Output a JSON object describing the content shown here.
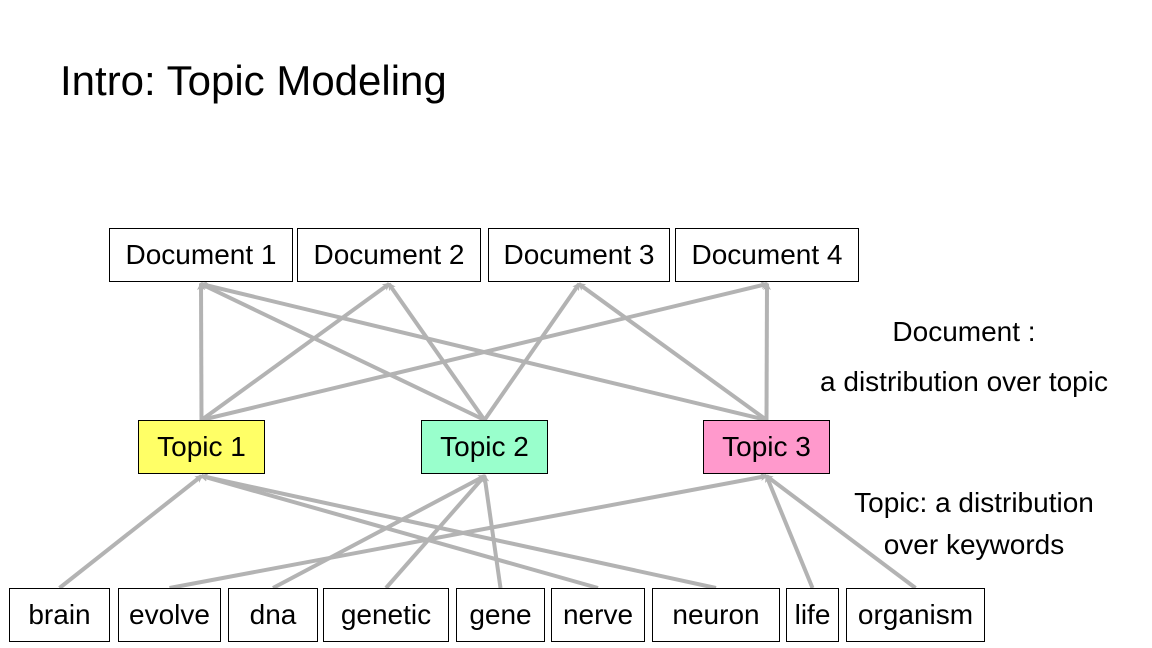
{
  "title": "Intro: Topic Modeling",
  "documents": [
    {
      "id": "d1",
      "label": "Document 1"
    },
    {
      "id": "d2",
      "label": "Document 2"
    },
    {
      "id": "d3",
      "label": "Document 3"
    },
    {
      "id": "d4",
      "label": "Document 4"
    }
  ],
  "topics": [
    {
      "id": "t1",
      "label": "Topic 1",
      "color": "#ffff66"
    },
    {
      "id": "t2",
      "label": "Topic 2",
      "color": "#99ffcc"
    },
    {
      "id": "t3",
      "label": "Topic 3",
      "color": "#ff99cc"
    }
  ],
  "words": [
    {
      "id": "brain",
      "label": "brain"
    },
    {
      "id": "evolve",
      "label": "evolve"
    },
    {
      "id": "dna",
      "label": "dna"
    },
    {
      "id": "genetic",
      "label": "genetic"
    },
    {
      "id": "gene",
      "label": "gene"
    },
    {
      "id": "nerve",
      "label": "nerve"
    },
    {
      "id": "neuron",
      "label": "neuron"
    },
    {
      "id": "life",
      "label": "life"
    },
    {
      "id": "organism",
      "label": "organism"
    }
  ],
  "topic_to_document_edges": [
    [
      "t1",
      "d1"
    ],
    [
      "t1",
      "d2"
    ],
    [
      "t1",
      "d4"
    ],
    [
      "t2",
      "d1"
    ],
    [
      "t2",
      "d2"
    ],
    [
      "t2",
      "d3"
    ],
    [
      "t3",
      "d1"
    ],
    [
      "t3",
      "d3"
    ],
    [
      "t3",
      "d4"
    ]
  ],
  "word_to_topic_edges": [
    [
      "brain",
      "t1"
    ],
    [
      "nerve",
      "t1"
    ],
    [
      "neuron",
      "t1"
    ],
    [
      "dna",
      "t2"
    ],
    [
      "genetic",
      "t2"
    ],
    [
      "gene",
      "t2"
    ],
    [
      "evolve",
      "t3"
    ],
    [
      "life",
      "t3"
    ],
    [
      "organism",
      "t3"
    ]
  ],
  "edge_color": "#b3b3b3",
  "notes": {
    "document_line1": "Document :",
    "document_line2": "a distribution over topic",
    "topic_line1": "Topic: a distribution",
    "topic_line2": "over keywords"
  }
}
